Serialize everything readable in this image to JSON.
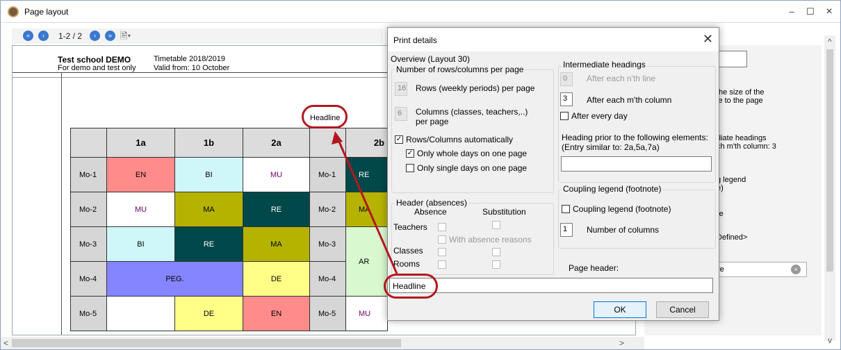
{
  "window": {
    "title": "Page layout",
    "min": "–",
    "max": "☐",
    "close": "×"
  },
  "toolbar": {
    "pages": "1-2 / 2",
    "icons": [
      "first-page-icon",
      "previous-page-icon",
      "next-page-icon",
      "last-page-icon",
      "page-menu-icon"
    ]
  },
  "preview": {
    "school": "Test school  DEMO",
    "demo": "For demo and test only",
    "timetable": "Timetable 2018/2019",
    "valid": "Valid from: 10 October",
    "headline": "Headline",
    "columns": [
      "1a",
      "1b",
      "2a",
      "2b"
    ],
    "rows": [
      {
        "label": "Mo-1",
        "cells": [
          "EN",
          "BI",
          "MU",
          "Mo-1",
          "RE"
        ]
      },
      {
        "label": "Mo-2",
        "cells": [
          "MU",
          "MA",
          "RE",
          "Mo-2",
          "MA"
        ]
      },
      {
        "label": "Mo-3",
        "cells": [
          "BI",
          "RE",
          "MA",
          "Mo-3",
          "AR"
        ]
      },
      {
        "label": "Mo-4",
        "cells": [
          "PEG.",
          "DE",
          "Mo-4"
        ]
      },
      {
        "label": "Mo-5",
        "cells": [
          "",
          "DE",
          "EN",
          "Mo-5",
          "MU"
        ]
      }
    ],
    "colors": {
      "red": "#ff8b8b",
      "cyan": "#cff6f8",
      "olive": "#b5b300",
      "dark": "#00484a",
      "violet": "#8585ff",
      "yellow": "#ffff88",
      "green": "#d8f8d0"
    }
  },
  "right_panel": {
    "size_text_1": "the size of the",
    "size_text_2": "le to the page",
    "heading_text_1": "diate headings",
    "heading_text_2": "ch m'th column: 3",
    "legend_text_1": "g legend",
    "legend_text_2": "e)",
    "text_re": "re",
    "defined": "Defined>",
    "re_button": "re"
  },
  "dialog": {
    "title": "Print details",
    "overview": "Overview (Layout 30)",
    "rows_cols_group": "Number of rows/columns per page",
    "rows_value": "16",
    "rows_label": "Rows (weekly periods) per page",
    "cols_value": "6",
    "cols_label": "Columns (classes, teachers,..) per page",
    "auto_label": "Rows/Columns automatically",
    "whole_days": "Only whole days on one page",
    "single_days": "Only single days on one page",
    "header_group": "Header (absences)",
    "absence": "Absence",
    "substitution": "Substitution",
    "teachers": "Teachers",
    "absence_reasons": "With absence reasons",
    "classes": "Classes",
    "rooms": "Rooms",
    "inter_group": "Intermediate headings",
    "nth_line_value": "0",
    "nth_line_label": "After each n'th line",
    "mth_col_value": "3",
    "mth_col_label": "After each m'th column",
    "every_day": "After every day",
    "heading_prior_1": "Heading prior to the following elements:",
    "heading_prior_2": "(Entry similar to: 2a,5a,7a)",
    "coupling_group": "Coupling legend (footnote)",
    "coupling_cb": "Coupling legend (footnote)",
    "num_cols_value": "1",
    "num_cols_label": "Number of columns",
    "page_header_label": "Page header:",
    "page_header_value": "Headline",
    "ok": "OK",
    "cancel": "Cancel"
  }
}
